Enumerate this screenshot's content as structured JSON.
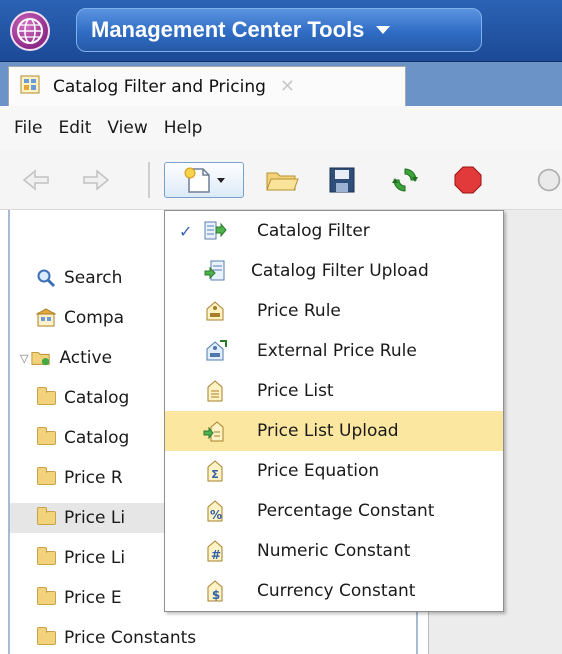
{
  "app": {
    "tools_label": "Management Center Tools"
  },
  "tab": {
    "label": "Catalog Filter and Pricing"
  },
  "menubar": {
    "items": [
      "File",
      "Edit",
      "View",
      "Help"
    ]
  },
  "tree": {
    "items": [
      {
        "label": "Search",
        "icon": "search-icon"
      },
      {
        "label": "Compa",
        "icon": "store-icon"
      },
      {
        "label": "Active ",
        "icon": "folder-open-icon"
      },
      {
        "label": "Catalog",
        "icon": "folder-icon"
      },
      {
        "label": "Catalog",
        "icon": "folder-icon"
      },
      {
        "label": "Price R",
        "icon": "folder-icon"
      },
      {
        "label": "Price Li",
        "icon": "folder-icon"
      },
      {
        "label": "Price Li",
        "icon": "folder-icon"
      },
      {
        "label": "Price E",
        "icon": "folder-icon"
      },
      {
        "label": "Price Constants",
        "icon": "folder-icon"
      }
    ]
  },
  "dropdown": {
    "items": [
      {
        "label": "Catalog Filter",
        "icon": "catalog-filter-icon",
        "checked": true
      },
      {
        "label": "Catalog Filter Upload",
        "icon": "catalog-filter-upload-icon"
      },
      {
        "label": "Price Rule",
        "icon": "price-rule-icon"
      },
      {
        "label": "External Price Rule",
        "icon": "external-price-rule-icon"
      },
      {
        "label": "Price List",
        "icon": "price-list-icon"
      },
      {
        "label": "Price List Upload",
        "icon": "price-list-upload-icon",
        "highlighted": true
      },
      {
        "label": "Price Equation",
        "icon": "price-equation-icon"
      },
      {
        "label": "Percentage Constant",
        "icon": "percentage-constant-icon"
      },
      {
        "label": "Numeric Constant",
        "icon": "numeric-constant-icon"
      },
      {
        "label": "Currency Constant",
        "icon": "currency-constant-icon"
      }
    ],
    "checkmark": "✓"
  },
  "colors": {
    "header_blue": "#2c62b4",
    "highlight": "#fce7a0",
    "folder": "#f2d27a"
  }
}
